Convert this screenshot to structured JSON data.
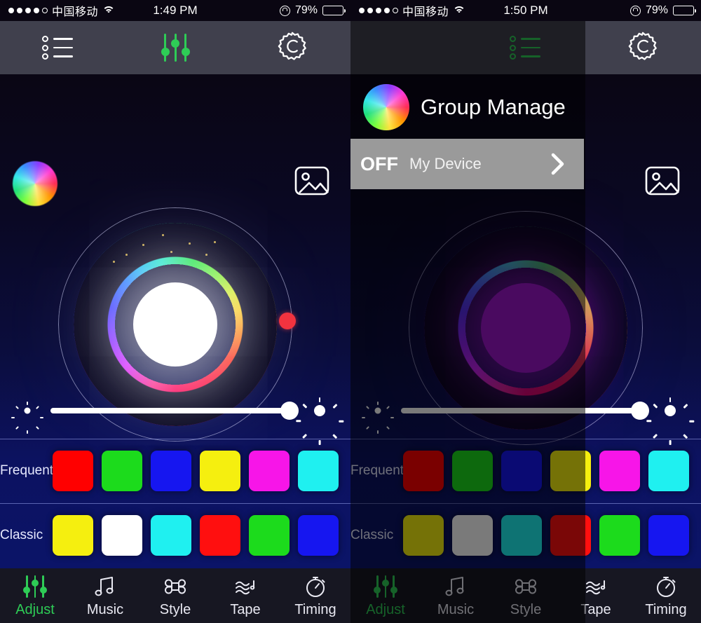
{
  "left": {
    "status_bar": {
      "signal_dots_filled": 4,
      "signal_dots_total": 5,
      "carrier": "中国移动",
      "wifi_icon": "wifi-icon",
      "time": "1:49 PM",
      "orientation_lock_icon": "rotation-lock-icon",
      "battery_percent": "79%",
      "battery_level": 79,
      "battery_color": "#f5c518"
    },
    "toolbar": {
      "list_icon": "list-icon",
      "sliders_icon": "sliders-icon",
      "gear_icon": "gear-icon",
      "active": "sliders-icon",
      "accent": "#2ecc56",
      "background": "#40404d"
    },
    "stage": {
      "avatar_icon": "color-wheel-icon",
      "image_picker_icon": "image-picker-icon",
      "color_wheel": {
        "selected_hex": "#ffffff",
        "handle_color": "#f2333f",
        "handle_angle_deg": 100
      },
      "brightness": {
        "min_icon": "sun-small-icon",
        "max_icon": "sun-large-icon",
        "value": 100,
        "track_color": "#ffffff"
      }
    },
    "palettes": [
      {
        "label": "Frequently",
        "colors": [
          "#ff0000",
          "#1cdb1c",
          "#1616f0",
          "#f5ef0f",
          "#f715e8",
          "#1ff0f0"
        ]
      },
      {
        "label": "Classic",
        "colors": [
          "#f5ef0f",
          "#ffffff",
          "#1ff0f0",
          "#ff0f0f",
          "#1cdb1c",
          "#1616f0"
        ]
      }
    ],
    "tabs": [
      {
        "label": "Adjust",
        "icon": "sliders-icon",
        "active": true
      },
      {
        "label": "Music",
        "icon": "music-note-icon",
        "active": false
      },
      {
        "label": "Style",
        "icon": "style-loop-icon",
        "active": false
      },
      {
        "label": "Tape",
        "icon": "tape-waves-icon",
        "active": false
      },
      {
        "label": "Timing",
        "icon": "stopwatch-icon",
        "active": false
      }
    ]
  },
  "right": {
    "status_bar": {
      "signal_dots_filled": 4,
      "signal_dots_total": 5,
      "carrier": "中国移动",
      "wifi_icon": "wifi-icon",
      "time": "1:50 PM",
      "orientation_lock_icon": "rotation-lock-icon",
      "battery_percent": "79%",
      "battery_level": 79,
      "battery_color": "#f5c518"
    },
    "toolbar": {
      "list_icon": "list-icon",
      "sliders_icon": "sliders-icon",
      "gear_icon": "gear-icon",
      "active": "list-icon",
      "accent": "#2ecc56",
      "background": "#40404d"
    },
    "group_manage": {
      "avatar_icon": "color-wheel-icon",
      "title": "Group Manage",
      "device_row": {
        "state": "OFF",
        "name": "My Device",
        "chevron_icon": "chevron-right-icon",
        "row_background": "#9a9a9a"
      }
    },
    "stage": {
      "image_picker_icon": "image-picker-icon",
      "color_wheel": {
        "selected_hex": "#9b15c8",
        "handle_color": "#f2333f",
        "handle_angle_deg": 100
      },
      "brightness": {
        "min_icon": "sun-small-icon",
        "max_icon": "sun-large-icon",
        "value": 100,
        "track_color": "#ffffff"
      }
    },
    "palettes": [
      {
        "label": "Frequently",
        "colors": [
          "#ff0000",
          "#1cdb1c",
          "#1616f0",
          "#f5ef0f",
          "#f715e8",
          "#1ff0f0"
        ]
      },
      {
        "label": "Classic",
        "colors": [
          "#f5ef0f",
          "#ffffff",
          "#1ff0f0",
          "#ff0f0f",
          "#1cdb1c",
          "#1616f0"
        ]
      }
    ],
    "tabs": [
      {
        "label": "Adjust",
        "icon": "sliders-icon",
        "active": true
      },
      {
        "label": "Music",
        "icon": "music-note-icon",
        "active": false
      },
      {
        "label": "Style",
        "icon": "style-loop-icon",
        "active": false
      },
      {
        "label": "Tape",
        "icon": "tape-waves-icon",
        "active": false
      },
      {
        "label": "Timing",
        "icon": "stopwatch-icon",
        "active": false
      }
    ]
  }
}
